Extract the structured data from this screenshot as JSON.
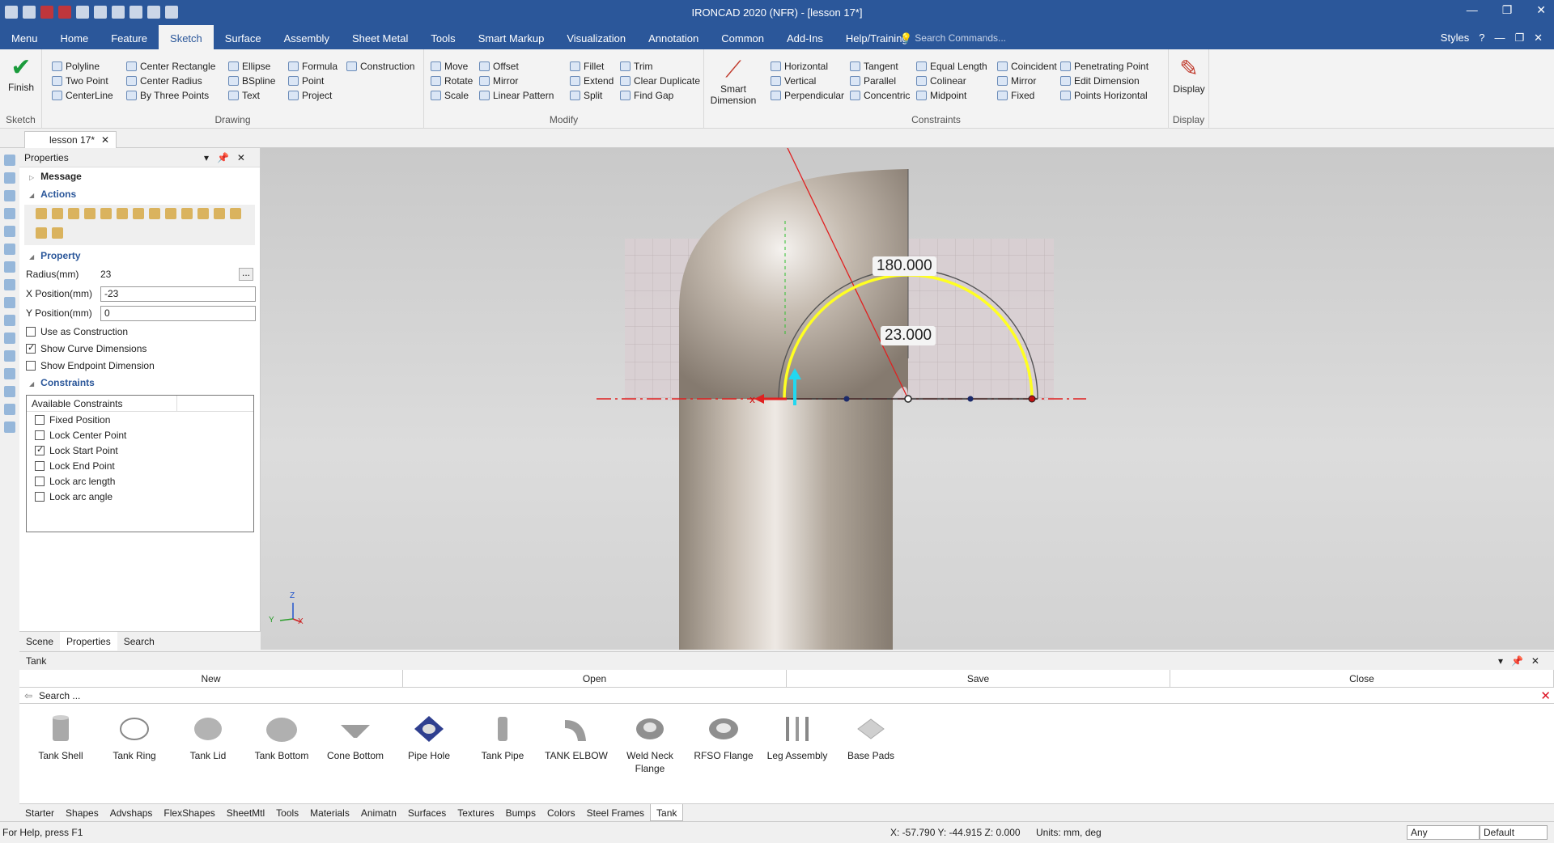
{
  "window": {
    "title": "IRONCAD 2020 (NFR) - [lesson 17*]"
  },
  "menu": {
    "tabs": [
      "Menu",
      "Home",
      "Feature",
      "Sketch",
      "Surface",
      "Assembly",
      "Sheet Metal",
      "Tools",
      "Smart Markup",
      "Visualization",
      "Annotation",
      "Common",
      "Add-Ins",
      "Help/Training"
    ],
    "active": "Sketch",
    "search_placeholder": "Search Commands...",
    "styles_label": "Styles"
  },
  "ribbon": {
    "sketch": {
      "label": "Sketch",
      "finish": "Finish"
    },
    "drawing": {
      "label": "Drawing",
      "col1": [
        "Polyline",
        "Two Point",
        "CenterLine"
      ],
      "col2": [
        "Center Rectangle",
        "Center Radius",
        "By Three Points"
      ],
      "col3": [
        "Ellipse",
        "BSpline",
        "Text"
      ],
      "col4": [
        "Formula",
        "Point",
        "Project"
      ],
      "col5": [
        "Construction"
      ]
    },
    "modify": {
      "label": "Modify",
      "col1": [
        "Move",
        "Rotate",
        "Scale"
      ],
      "col2": [
        "Offset",
        "Mirror",
        "Linear Pattern"
      ],
      "col3": [
        "Fillet",
        "Extend",
        "Split"
      ],
      "col4": [
        "Trim",
        "Clear Duplicate",
        "Find Gap"
      ]
    },
    "constraints": {
      "label": "Constraints",
      "smart": "Smart Dimension",
      "col1": [
        "Horizontal",
        "Vertical",
        "Perpendicular"
      ],
      "col2": [
        "Tangent",
        "Parallel",
        "Concentric"
      ],
      "col3": [
        "Equal Length",
        "Colinear",
        "Midpoint"
      ],
      "col4": [
        "Coincident",
        "Mirror",
        "Fixed"
      ],
      "col5": [
        "Penetrating Point",
        "Edit Dimension",
        "Points Horizontal"
      ]
    },
    "display": {
      "label": "Display",
      "btn": "Display"
    }
  },
  "doc_tab": "lesson 17*",
  "properties": {
    "title": "Properties",
    "message": "Message",
    "actions": "Actions",
    "property": "Property",
    "radius_label": "Radius(mm)",
    "radius_value": "23",
    "xpos_label": "X Position(mm)",
    "xpos_value": "-23",
    "ypos_label": "Y Position(mm)",
    "ypos_value": "0",
    "checks": [
      {
        "label": "Use as Construction",
        "checked": false
      },
      {
        "label": "Show Curve Dimensions",
        "checked": true
      },
      {
        "label": "Show Endpoint Dimension",
        "checked": false
      }
    ],
    "constraints_title": "Constraints",
    "available": "Available Constraints",
    "constraints": [
      {
        "label": "Fixed Position",
        "checked": false
      },
      {
        "label": "Lock Center Point",
        "checked": false
      },
      {
        "label": "Lock Start Point",
        "checked": true
      },
      {
        "label": "Lock End Point",
        "checked": false
      },
      {
        "label": "Lock arc length",
        "checked": false
      },
      {
        "label": "Lock arc angle",
        "checked": false
      }
    ],
    "tabs": [
      "Scene",
      "Properties",
      "Search"
    ]
  },
  "viewport": {
    "dim_angle": "180.000",
    "dim_radius": "23.000",
    "axes": {
      "z": "Z",
      "y": "Y",
      "x": "X"
    }
  },
  "catalog": {
    "title": "Tank",
    "buttons": [
      "New",
      "Open",
      "Save",
      "Close"
    ],
    "search_placeholder": "Search ...",
    "items": [
      "Tank Shell",
      "Tank Ring",
      "Tank Lid",
      "Tank Bottom",
      "Cone Bottom",
      "Pipe Hole",
      "Tank Pipe",
      "TANK ELBOW",
      "Weld Neck Flange",
      "RFSO Flange",
      "Leg Assembly",
      "Base Pads"
    ],
    "tabs": [
      "Starter",
      "Shapes",
      "Advshaps",
      "FlexShapes",
      "SheetMtl",
      "Tools",
      "Materials",
      "Animatn",
      "Surfaces",
      "Textures",
      "Bumps",
      "Colors",
      "Steel Frames",
      "Tank"
    ],
    "active_tab": "Tank"
  },
  "status": {
    "help": "For Help, press F1",
    "coords": "X: -57.790 Y: -44.915 Z: 0.000",
    "units_label": "Units:",
    "units_value": "mm, deg",
    "filter": "Any",
    "mode": "Default"
  }
}
